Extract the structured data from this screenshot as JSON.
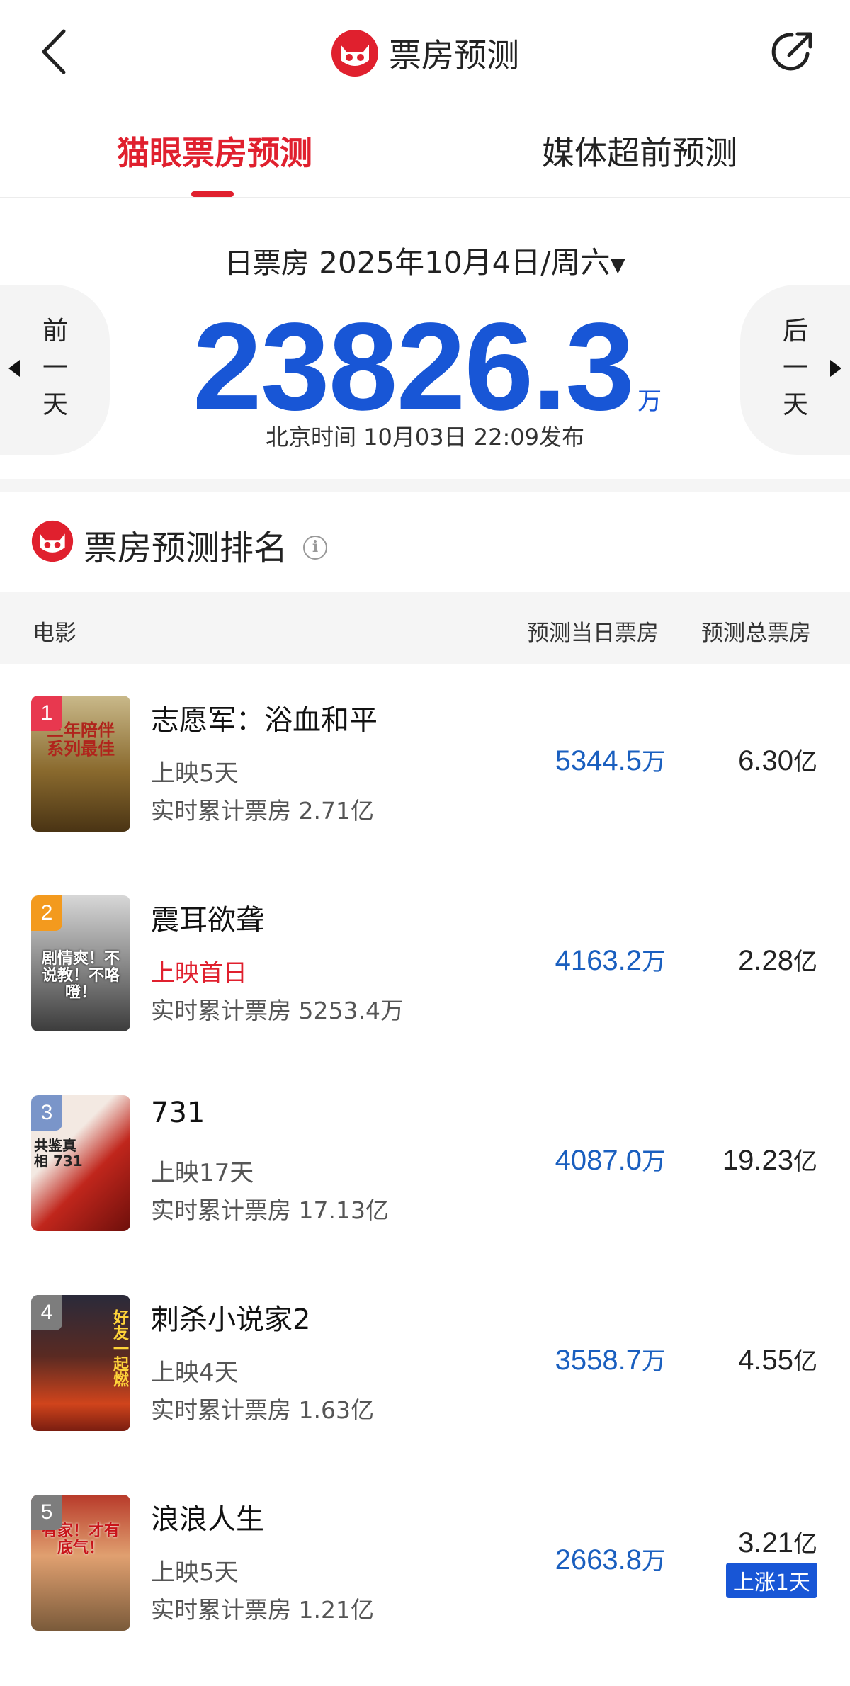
{
  "header": {
    "title": "票房预测",
    "logo_icon": "cat-eye-logo-icon",
    "back_icon": "chevron-left-icon",
    "share_icon": "share-icon"
  },
  "tabs": [
    {
      "label": "猫眼票房预测",
      "active": true
    },
    {
      "label": "媒体超前预测",
      "active": false
    }
  ],
  "daily": {
    "label": "日票房",
    "date": "2025年10月4日/周六",
    "amount": "23826.3",
    "unit": "万",
    "publish": "北京时间  10月03日  22:09发布",
    "prev": [
      "前",
      "一",
      "天"
    ],
    "next": [
      "后",
      "一",
      "天"
    ]
  },
  "ranking": {
    "title": "票房预测排名",
    "columns": {
      "movie": "电影",
      "day": "预测当日票房",
      "total": "预测总票房"
    },
    "movies": [
      {
        "rank": "1",
        "title": "志愿军：浴血和平",
        "days": "上映5天",
        "cumulative": "实时累计票房 2.71亿",
        "day_value": "5344.5",
        "day_unit": "万",
        "total_value": "6.30",
        "total_unit": "亿",
        "tag": "",
        "poster_text": "三年陪伴 系列最佳",
        "badge_color": "#e8384f"
      },
      {
        "rank": "2",
        "title": "震耳欲聋",
        "days": "上映首日",
        "days_highlight": true,
        "cumulative": "实时累计票房 5253.4万",
        "day_value": "4163.2",
        "day_unit": "万",
        "total_value": "2.28",
        "total_unit": "亿",
        "tag": "",
        "poster_text": "剧情爽！不说教！不咯噔！",
        "badge_color": "#f39a1e"
      },
      {
        "rank": "3",
        "title": "731",
        "days": "上映17天",
        "cumulative": "实时累计票房 17.13亿",
        "day_value": "4087.0",
        "day_unit": "万",
        "total_value": "19.23",
        "total_unit": "亿",
        "tag": "",
        "poster_text": "共鉴真相 731",
        "badge_color": "#7a95c9"
      },
      {
        "rank": "4",
        "title": "刺杀小说家2",
        "days": "上映4天",
        "cumulative": "实时累计票房 1.63亿",
        "day_value": "3558.7",
        "day_unit": "万",
        "total_value": "4.55",
        "total_unit": "亿",
        "tag": "",
        "poster_text": "好友一起燃",
        "badge_color": "#7d7d7d"
      },
      {
        "rank": "5",
        "title": "浪浪人生",
        "days": "上映5天",
        "cumulative": "实时累计票房 1.21亿",
        "day_value": "2663.8",
        "day_unit": "万",
        "total_value": "3.21",
        "total_unit": "亿",
        "tag": "上涨1天",
        "poster_text": "有家！才有底气！",
        "badge_color": "#7d7d7d"
      }
    ]
  }
}
